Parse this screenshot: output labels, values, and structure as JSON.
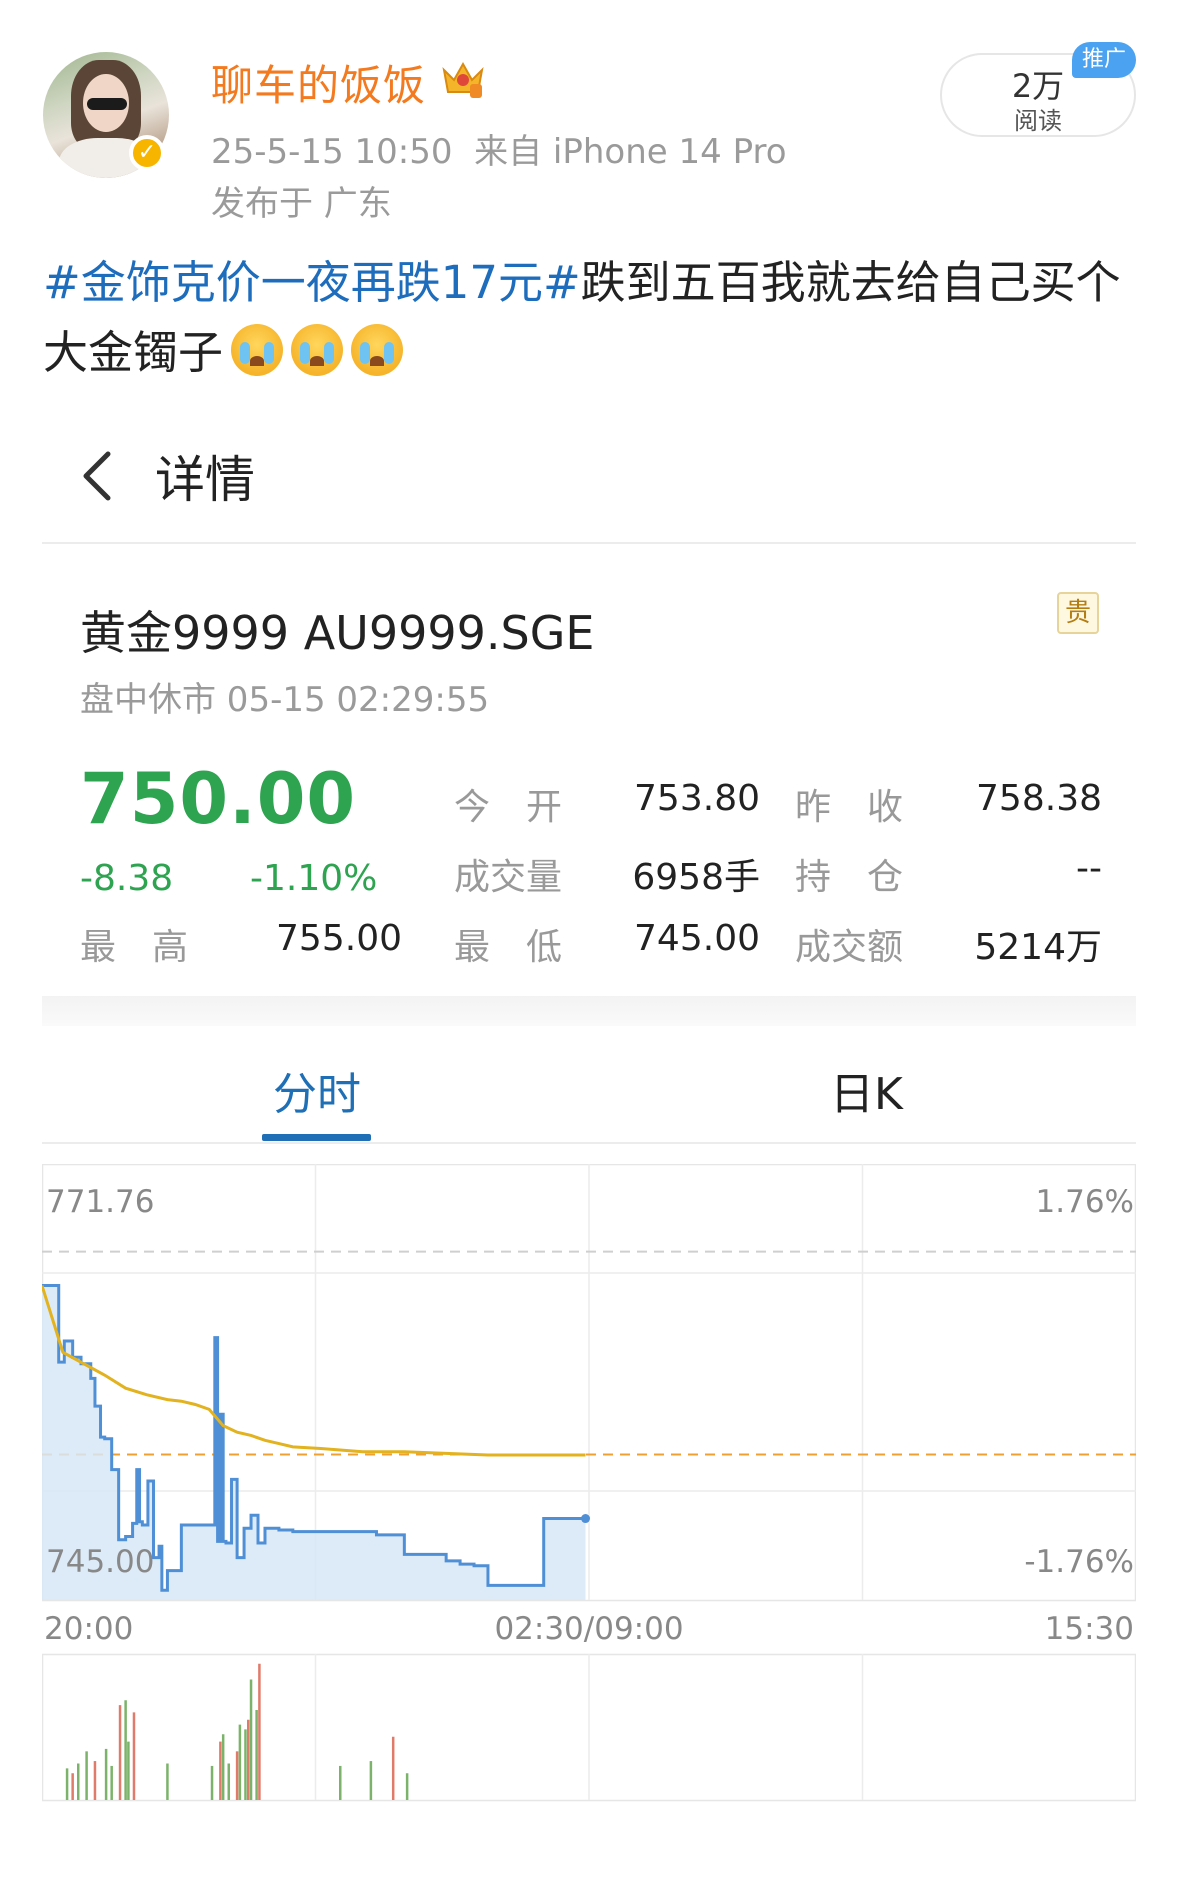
{
  "post": {
    "username": "聊车的饭饭",
    "time": "25-5-15 10:50",
    "source": "来自 iPhone 14 Pro",
    "location": "发布于 广东",
    "reads_count": "2万",
    "reads_label": "阅读",
    "promo_badge": "推广",
    "hashtag": "#金饰克价一夜再跌17元#",
    "text": "跌到五百我就去给自己买个大金镯子",
    "emoji_name": "crying-face-icon"
  },
  "app": {
    "back_icon": "chevron-left-icon",
    "title": "详情",
    "stock_name": "黄金9999 AU9999.SGE",
    "badge": "贵",
    "status": "盘中休市  05-15 02:29:55",
    "price": "750.00",
    "change": "-8.38",
    "change_pct": "-1.10%",
    "high_label": "最　高",
    "high": "755.00",
    "quotes": [
      {
        "label": "今　开",
        "value": "753.80"
      },
      {
        "label": "昨　收",
        "value": "758.38"
      },
      {
        "label": "成交量",
        "value": "6958手"
      },
      {
        "label": "持　仓",
        "value": "--"
      },
      {
        "label": "最　低",
        "value": "745.00"
      },
      {
        "label": "成交额",
        "value": "5214万"
      }
    ],
    "tabs": [
      {
        "label": "分时",
        "active": true
      },
      {
        "label": "日K",
        "active": false
      }
    ]
  },
  "colors": {
    "up_green": "#2ea350",
    "price_line": "#4f8fd6",
    "avg_line": "#e2b21f",
    "prev_close_line": "#f0a030",
    "hashtag": "#1e6dbd",
    "username": "#f47a1f"
  },
  "chart_data": {
    "type": "line",
    "y_top_label": "771.76",
    "y_bottom_label": "745.00",
    "pct_top_label": "1.76%",
    "pct_bottom_label": "-1.76%",
    "x_labels": [
      "20:00",
      "02:30/09:00",
      "15:30"
    ],
    "ylim": [
      745.0,
      771.76
    ],
    "prev_close": 758.38,
    "x_span_minutes": 785,
    "series": [
      {
        "x": [
          0,
          12,
          12,
          16,
          22,
          28,
          35,
          38,
          42,
          45,
          50,
          55,
          60,
          65,
          68,
          70,
          72,
          76,
          80,
          84,
          86,
          90,
          100,
          110,
          120,
          124,
          126,
          128,
          130,
          132,
          136,
          140,
          145,
          150,
          155,
          160,
          170,
          180,
          190,
          200,
          220,
          240,
          260,
          270,
          280,
          290,
          300,
          310,
          320,
          330,
          340,
          350,
          360,
          370,
          380,
          390
        ],
        "values": [
          764.3,
          764.3,
          759.6,
          760.9,
          759.9,
          759.5,
          758.6,
          756.9,
          755.0,
          754.9,
          753.0,
          748.7,
          748.9,
          749.7,
          753.0,
          749.8,
          749.6,
          752.3,
          747.6,
          748.3,
          745.6,
          746.8,
          749.6,
          749.6,
          749.6,
          761.1,
          748.6,
          756.4,
          748.6,
          748.5,
          752.4,
          747.6,
          749.4,
          750.2,
          748.5,
          749.4,
          749.3,
          749.2,
          749.2,
          749.2,
          749.2,
          749.0,
          747.8,
          747.8,
          747.8,
          747.4,
          747.2,
          747.1,
          745.9,
          745.9,
          745.9,
          745.9,
          750.0,
          750.0,
          750.0,
          750.0
        ]
      },
      {
        "x": [
          0,
          15,
          30,
          45,
          60,
          75,
          90,
          100,
          110,
          120,
          130,
          140,
          150,
          160,
          170,
          180,
          200,
          230,
          260,
          290,
          320,
          340,
          360,
          370,
          390
        ],
        "values": [
          764.3,
          760.2,
          759.5,
          758.8,
          758.0,
          757.6,
          757.3,
          757.2,
          757.0,
          756.7,
          755.7,
          755.3,
          755.1,
          754.8,
          754.6,
          754.4,
          754.3,
          754.1,
          754.1,
          754.0,
          753.9,
          753.9,
          753.9,
          753.9,
          753.9
        ]
      }
    ],
    "volume": {
      "x": [
        18,
        22,
        26,
        32,
        38,
        46,
        50,
        56,
        60,
        62,
        66,
        90,
        122,
        128,
        130,
        134,
        140,
        142,
        146,
        148,
        150,
        154,
        156,
        214,
        236,
        252,
        262
      ],
      "values": [
        26,
        22,
        30,
        40,
        32,
        42,
        28,
        78,
        82,
        48,
        72,
        30,
        28,
        48,
        54,
        30,
        40,
        62,
        58,
        66,
        99,
        74,
        112,
        28,
        32,
        52,
        22
      ]
    }
  }
}
